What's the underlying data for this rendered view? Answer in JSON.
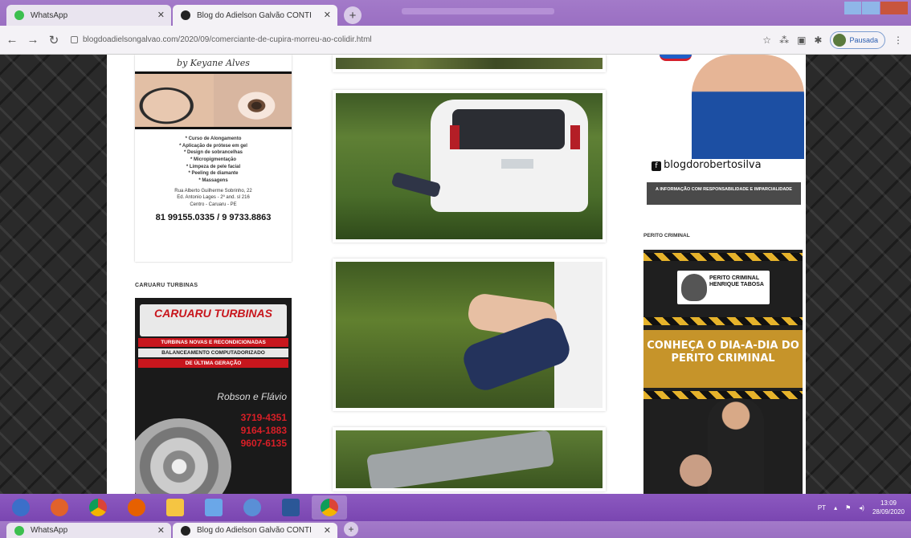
{
  "browser": {
    "tabs": [
      {
        "label": "WhatsApp",
        "favicon_color": "#3cbf4f",
        "active": false
      },
      {
        "label": "Blog do Adielson Galvão CONTI",
        "favicon_color": "#222222",
        "active": true
      }
    ],
    "address": "blogdoadielsongalvao.com/2020/09/comerciante-de-cupira-morreu-ao-colidir.html",
    "profile_label": "Pausada",
    "accent": "#9a6fc2"
  },
  "left_sidebar": {
    "nails_ad": {
      "signature": "by Keyane Alves",
      "services": [
        "* Curso de Alongamento",
        "* Aplicação de prótese em gel",
        "* Design de sobrancelhas",
        "* Micropigmentação",
        "* Limpeza de pele facial",
        "* Peeling de diamante",
        "* Massagens"
      ],
      "address_lines": [
        "Rua Alberto Guilherme Sobrinho, 22",
        "Ed. Antonio Lages - 2º and. sl 216",
        "Centro - Caruaru - PE"
      ],
      "phone": "81 99155.0335 / 9 9733.8863"
    },
    "turbo_section_title": "CARUARU TURBINAS",
    "turbo_ad": {
      "brand": "CARUARU TURBINAS",
      "lines": [
        "TURBINAS NOVAS E RECONDICIONADAS",
        "BALANCEAMENTO COMPUTADORIZADO",
        "DE ÚLTIMA GERAÇÃO"
      ],
      "names": "Robson e Flávio",
      "phones": [
        "3719-4351",
        "9164-1883",
        "9607-6135"
      ]
    }
  },
  "right_sidebar": {
    "roberto_ad": {
      "handle": "blogdorobertosilva",
      "tagline": "A INFORMAÇÃO COM RESPONSABILIDADE E IMPARCIALIDADE"
    },
    "perito_title": "PERITO CRIMINAL",
    "perito_ad": {
      "badge_top": "PERITO CRIMINAL",
      "badge_name": "HENRIQUE TABOSA",
      "headline": "CONHEÇA O DIA-A-DIA DO PERITO CRIMINAL"
    }
  },
  "taskbar": {
    "apps": [
      {
        "name": "start-orb-icon",
        "color": "#3b6fc9"
      },
      {
        "name": "media-player-icon",
        "color": "#e1622b"
      },
      {
        "name": "chrome-icon",
        "color": "#f2b705"
      },
      {
        "name": "firefox-icon",
        "color": "#e66000"
      },
      {
        "name": "folder-icon",
        "color": "#f5c542"
      },
      {
        "name": "notepad-icon",
        "color": "#6aa7e8"
      },
      {
        "name": "app-icon",
        "color": "#5a8fd6"
      },
      {
        "name": "word-icon",
        "color": "#2b5797"
      },
      {
        "name": "chrome-icon-2",
        "color": "#f2b705"
      }
    ],
    "time": "13:09",
    "date": "28/09/2020",
    "lang": "PT"
  }
}
